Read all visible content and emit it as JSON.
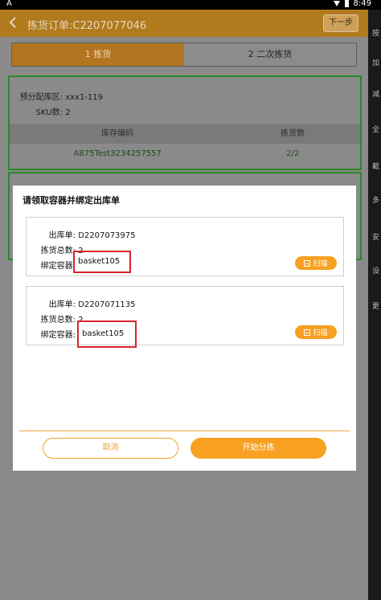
{
  "status_bar": {
    "left_glyph": "A",
    "time": "8:49"
  },
  "header": {
    "title": "拣货订单:C2207077046",
    "next_label": "下一步"
  },
  "tabs": [
    {
      "label": "1 拣货",
      "active": true
    },
    {
      "label": "2 二次拣货",
      "active": false
    }
  ],
  "summary": {
    "area_label": "预分配库区:",
    "area_value": "xxx1-119",
    "sku_label": "SKU数:",
    "sku_value": "2",
    "columns": [
      "库存编码",
      "拣货数"
    ],
    "rows": [
      {
        "code": "A875Test3234257557",
        "qty": "2/2"
      }
    ]
  },
  "nav": {
    "items": [
      "按",
      "加",
      "减",
      "全",
      "截",
      "多",
      "安",
      "设",
      "更"
    ]
  },
  "dialog": {
    "title": "请领取容器并绑定出库单",
    "orders": [
      {
        "order_label": "出库单:",
        "order_no": "D2207073975",
        "total_label": "拣货总数:",
        "total": "2",
        "container_label": "绑定容器:",
        "container": "basket105",
        "scan_label": "扫描"
      },
      {
        "order_label": "出库单:",
        "order_no": "D2207071135",
        "total_label": "拣货总数:",
        "total": "2",
        "container_label": "绑定容器:",
        "container": "basket105",
        "scan_label": "扫描"
      }
    ],
    "cancel_label": "取消",
    "start_label": "开始分拣"
  },
  "colors": {
    "accent": "#f7a022",
    "highlight": "#d6262b",
    "frame": "#2a8a26"
  }
}
